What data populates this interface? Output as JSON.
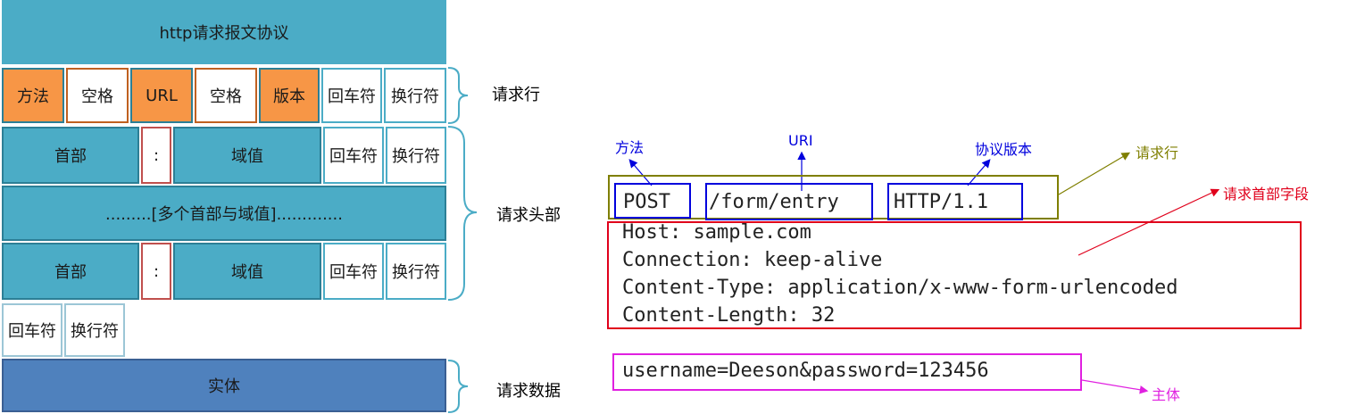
{
  "left": {
    "title": "http请求报文协议",
    "request_line": {
      "method": "方法",
      "space1": "空格",
      "url": "URL",
      "space2": "空格",
      "version": "版本",
      "cr": "回车符",
      "lf": "换行符"
    },
    "header_row1": {
      "name": "首部",
      "colon": ":",
      "value": "域值",
      "cr": "回车符",
      "lf": "换行符"
    },
    "multi_headers": ".........[多个首部与域值].............",
    "header_row2": {
      "name": "首部",
      "colon": ":",
      "value": "域值",
      "cr": "回车符",
      "lf": "换行符"
    },
    "blank_line": {
      "cr": "回车符",
      "lf": "换行符"
    },
    "body": "实体",
    "labels": {
      "request_line": "请求行",
      "request_headers": "请求头部",
      "request_data": "请求数据"
    }
  },
  "right": {
    "annotations": {
      "method": "方法",
      "uri": "URI",
      "protocol_version": "协议版本",
      "request_line": "请求行",
      "request_header_fields": "请求首部字段",
      "body": "主体"
    },
    "request_line": {
      "method": "POST",
      "uri": "/form/entry",
      "version": "HTTP/1.1"
    },
    "headers": [
      "Host: sample.com",
      "Connection: keep-alive",
      "Content-Type: application/x-www-form-urlencoded",
      "Content-Length: 32"
    ],
    "body": "username=Deeson&password=123456"
  },
  "colors": {
    "teal": "#4bacc6",
    "orange": "#f79646",
    "blue": "#4f81bd",
    "olive": "#7f7f00",
    "red": "#e0001b",
    "magenta": "#e020e0",
    "annotation_blue": "#0000dd"
  }
}
